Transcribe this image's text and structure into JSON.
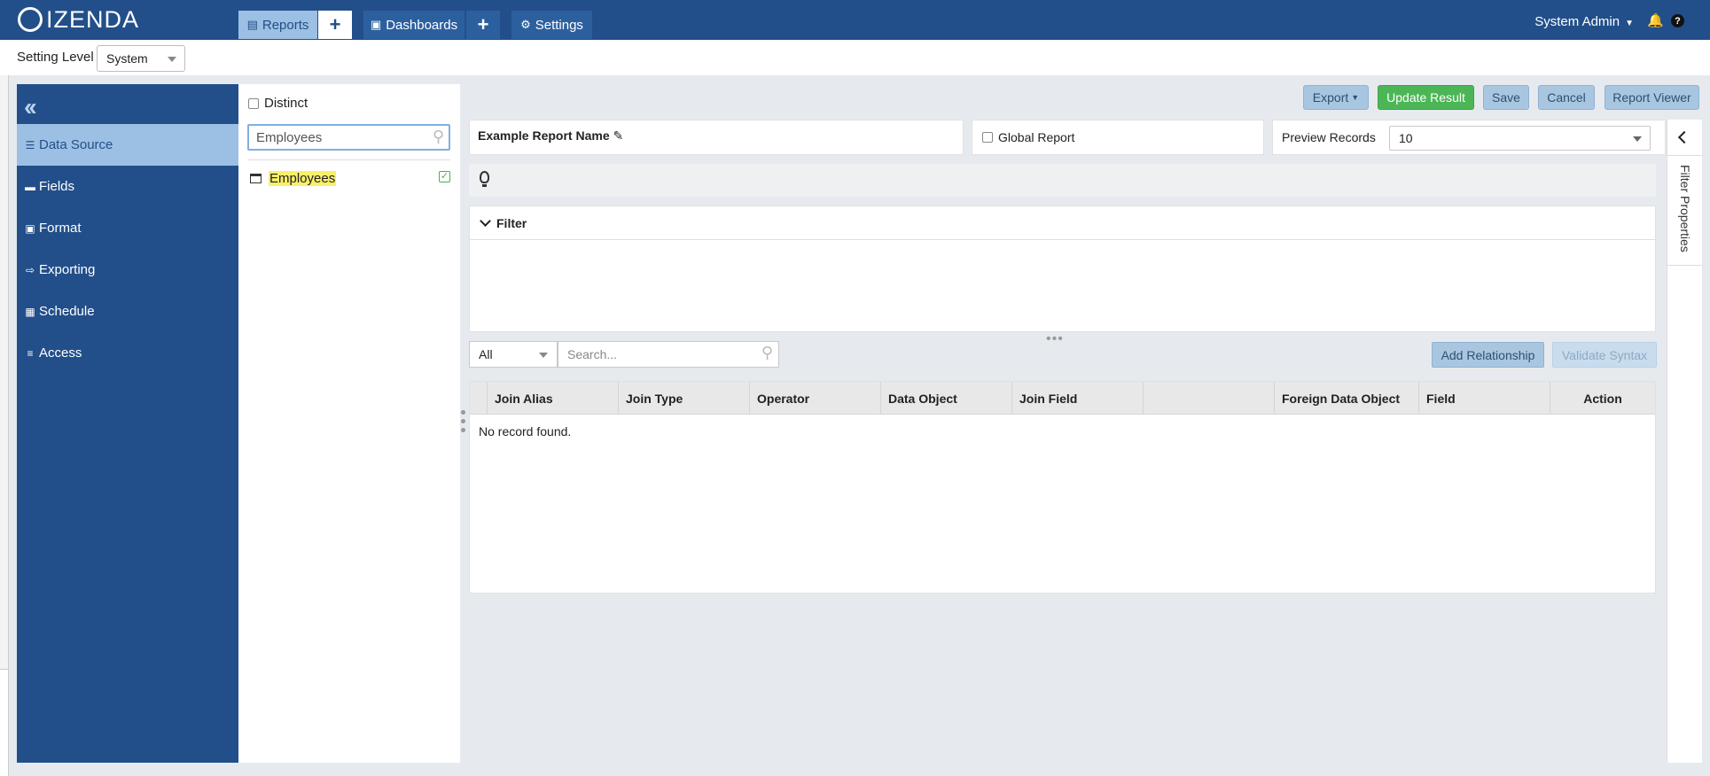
{
  "topbar": {
    "brand": "IZENDA",
    "nav": [
      {
        "label": "Reports",
        "icon": "report-list-icon"
      },
      {
        "label": "+",
        "icon": "plus-icon"
      },
      {
        "label": "Dashboards",
        "icon": "monitor-icon"
      },
      {
        "label": "+",
        "icon": "plus-icon"
      },
      {
        "label": "Settings",
        "icon": "gear-icon"
      }
    ],
    "user": "System Admin"
  },
  "setting_level": {
    "label": "Setting Level",
    "value": "System"
  },
  "sidebar": {
    "items": [
      {
        "label": "Data Source",
        "icon": "database-icon"
      },
      {
        "label": "Fields",
        "icon": "field-icon"
      },
      {
        "label": "Format",
        "icon": "format-icon"
      },
      {
        "label": "Exporting",
        "icon": "export-icon"
      },
      {
        "label": "Schedule",
        "icon": "calendar-icon"
      },
      {
        "label": "Access",
        "icon": "access-icon"
      }
    ]
  },
  "data_source": {
    "distinct_label": "Distinct",
    "search_value": "Employees",
    "items": [
      {
        "name": "Employees",
        "checked": true
      }
    ]
  },
  "toolbar": {
    "export": "Export",
    "update": "Update Result",
    "save": "Save",
    "cancel": "Cancel",
    "viewer": "Report Viewer"
  },
  "report": {
    "name": "Example Report Name",
    "global_label": "Global Report",
    "preview_label": "Preview Records",
    "preview_value": "10"
  },
  "filter": {
    "title": "Filter"
  },
  "relationships": {
    "filter_value": "All",
    "search_placeholder": "Search...",
    "add_label": "Add Relationship",
    "validate_label": "Validate Syntax",
    "columns": [
      "Join Alias",
      "Join Type",
      "Operator",
      "Data Object",
      "Join Field",
      "",
      "Foreign Data Object",
      "Field",
      "Action"
    ],
    "empty_text": "No record found."
  },
  "right_panel": {
    "label": "Filter Properties"
  },
  "colors": {
    "brand": "#224f8a",
    "active": "#9cc0e3",
    "success": "#4cb657",
    "highlight": "#f9ef6a"
  }
}
